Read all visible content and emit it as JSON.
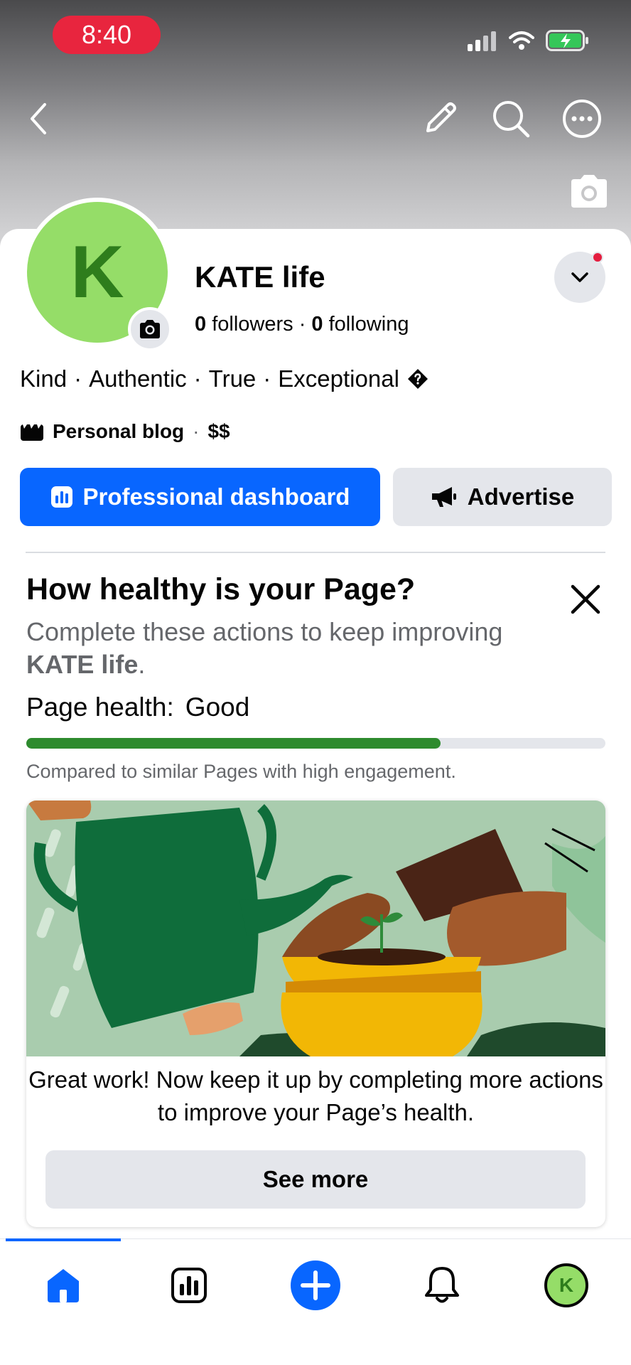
{
  "status_bar": {
    "time": "8:40"
  },
  "profile": {
    "avatar_initial": "K",
    "page_name": "KATE life",
    "followers_count": "0",
    "followers_label": "followers",
    "following_count": "0",
    "following_label": "following",
    "bio_words": [
      "Kind",
      "Authentic",
      "True",
      "Exceptional"
    ],
    "category": "Personal blog",
    "price_range": "$$"
  },
  "actions": {
    "professional_dashboard": "Professional dashboard",
    "advertise": "Advertise"
  },
  "health": {
    "title": "How healthy is your Page?",
    "subtitle_prefix": "Complete these actions to keep improving",
    "subtitle_page": "KATE life",
    "subtitle_suffix": ".",
    "label": "Page health:",
    "value": "Good",
    "progress_fraction": 0.715,
    "compared": "Compared to similar Pages with high engagement."
  },
  "card": {
    "message": "Great work! Now keep it up by completing more actions to improve your Page’s health.",
    "button": "See more"
  },
  "tabbar": {
    "profile_initial": "K"
  },
  "colors": {
    "accent": "#0866ff",
    "avatar": "#95dd68",
    "progress": "#2e8b2e",
    "status_pill": "#e8253e"
  }
}
